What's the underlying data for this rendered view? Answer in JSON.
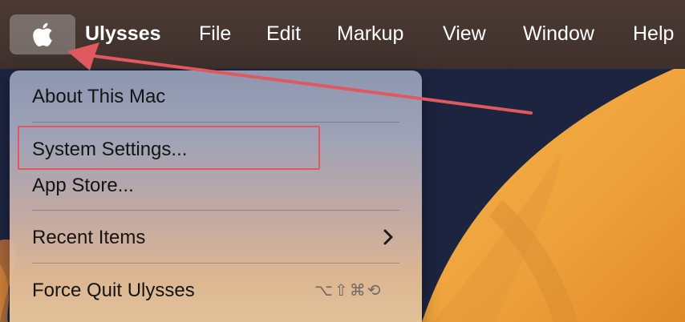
{
  "menubar": {
    "apple_icon": "apple-logo-icon",
    "app_name": "Ulysses",
    "menus": [
      "File",
      "Edit",
      "Markup",
      "View",
      "Window",
      "Help"
    ]
  },
  "apple_menu": {
    "items": [
      {
        "label": "About This Mac"
      },
      {
        "label": "System Settings..."
      },
      {
        "label": "App Store..."
      },
      {
        "label": "Recent Items",
        "submenu_icon": "chevron-right-icon"
      },
      {
        "label": "Force Quit Ulysses",
        "shortcut": "⌥⇧⌘⟲"
      }
    ]
  },
  "annotation": {
    "arrow_color": "#e0595f",
    "highlight_color": "#e0595f",
    "highlighted_item": "System Settings..."
  },
  "colors": {
    "menubar_bg": "#3e302c",
    "menubar_text": "#ffffff",
    "menu_text": "#141414",
    "wallpaper_orange": "#f2a93b"
  }
}
